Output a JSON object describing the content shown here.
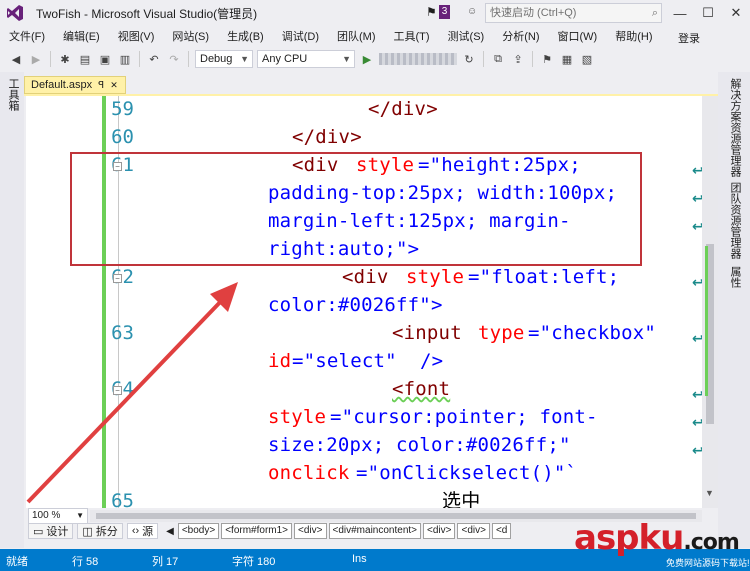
{
  "window": {
    "title": "TwoFish - Microsoft Visual Studio(管理员)",
    "notification_count": "3",
    "quick_launch_placeholder": "快速启动 (Ctrl+Q)",
    "minimize": "—",
    "maximize": "☐",
    "close": "✕"
  },
  "menu": {
    "items": [
      "文件(F)",
      "编辑(E)",
      "视图(V)",
      "网站(S)",
      "生成(B)",
      "调试(D)",
      "团队(M)",
      "工具(T)",
      "测试(S)",
      "分析(N)",
      "窗口(W)",
      "帮助(H)"
    ],
    "login": "登录"
  },
  "toolbar": {
    "configuration": "Debug",
    "platform": "Any CPU"
  },
  "left_strip": {
    "toolbox": "工具箱"
  },
  "right_strip": {
    "solution_explorer": "解决方案资源管理器",
    "team_explorer": "团队资源管理器",
    "properties": "属性"
  },
  "document": {
    "tab_name": "Default.aspx",
    "tab_pin": "ꟼ",
    "tab_close": "✕"
  },
  "editor": {
    "line_numbers": [
      "59",
      "60",
      "61",
      "62",
      "63",
      "64",
      "65"
    ],
    "lines": {
      "l59": "</div>",
      "l60": "</div>",
      "l61a_tag": "<div",
      "l61a_attr": "style",
      "l61a_rest": "=\"height:25px;",
      "l61b": "padding-top:25px; width:100px;",
      "l61c": "margin-left:125px; margin-",
      "l61d": "right:auto;\">",
      "l62a_tag": "<div",
      "l62a_attr": "style",
      "l62a_rest": "=\"float:left;",
      "l62b": "color:#0026ff\">",
      "l63a_tag": "<input",
      "l63a_attr": "type",
      "l63a_rest": "=\"checkbox\"",
      "l63b_attr": "id",
      "l63b_rest": "=\"select\"  />",
      "l64a": "<font",
      "l64b_attr": "style",
      "l64b_rest": "=\"cursor:pointer; font-",
      "l64c": "size:20px; color:#0026ff;\"",
      "l64d_attr": "onclick",
      "l64d_rest": "=\"onClickselect()\"`",
      "l65": "选中"
    }
  },
  "bottom": {
    "zoom": "100 %",
    "design": "设计",
    "split": "拆分",
    "source": "源",
    "breadcrumbs": [
      "<body>",
      "<form#form1>",
      "<div>",
      "<div#maincontent>",
      "<div>",
      "<div>",
      "<d"
    ]
  },
  "status": {
    "ready": "就绪",
    "line": "行 58",
    "col": "列 17",
    "char": "字符 180",
    "mode": "Ins"
  },
  "watermark": {
    "brand": "aspku",
    "tld": ".com",
    "sub": "免费网站源码下载站!"
  },
  "colors": {
    "status_bar": "#007acc",
    "tab_active": "#fff1a8",
    "annotation_red": "#c0343a",
    "change_margin": "#6ccf57"
  }
}
